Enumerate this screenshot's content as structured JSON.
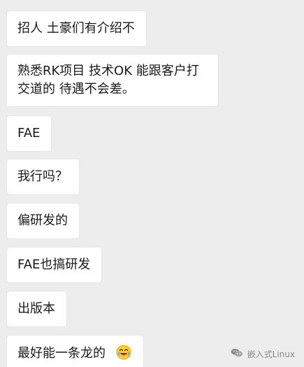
{
  "messages": [
    {
      "text": "招人 土豪们有介绍不"
    },
    {
      "text": "熟悉RK项目 技术OK 能跟客户打交道的 待遇不会差。"
    },
    {
      "text": "FAE"
    },
    {
      "text": "我行吗？"
    },
    {
      "text": "偏研发的"
    },
    {
      "text": "FAE也搞研发"
    },
    {
      "text": "出版本"
    },
    {
      "text": "最好能一条龙的",
      "emoji": "tears-of-joy-emoji"
    }
  ],
  "watermark": {
    "icon": "wechat-icon",
    "text": "嵌入式Linux"
  },
  "colors": {
    "background": "#ededed",
    "bubble": "#ffffff",
    "text": "#1a1a1a",
    "watermark": "#8a8a8a"
  }
}
